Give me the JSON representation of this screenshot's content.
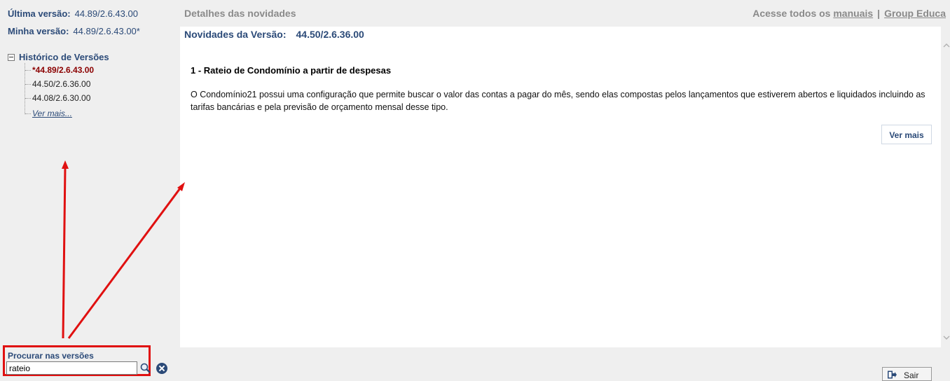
{
  "sidebar": {
    "ultima_label": "Última versão:",
    "ultima_value": "44.89/2.6.43.00",
    "minha_label": "Minha versão:",
    "minha_value": "44.89/2.6.43.00*",
    "history_title": "Histórico de Versões",
    "history_items": [
      {
        "label": "*44.89/2.6.43.00",
        "state": "current"
      },
      {
        "label": "44.50/2.6.36.00",
        "state": "normal"
      },
      {
        "label": "44.08/2.6.30.00",
        "state": "normal"
      }
    ],
    "ver_mais_link": "Ver mais..."
  },
  "search": {
    "label": "Procurar nas versões",
    "value": "rateio"
  },
  "header": {
    "title": "Detalhes das novidades",
    "links_prefix": "Acesse todos os",
    "manuais_link": "manuais",
    "separator": "|",
    "group_link": "Group Educa"
  },
  "content": {
    "novidades_label": "Novidades da Versão:",
    "novidades_version": "44.50/2.6.36.00",
    "item_title": "1 - Rateio de Condomínio a partir de despesas",
    "item_body": "O Condomínio21 possui uma configuração que permite buscar o valor das contas a pagar do mês, sendo elas compostas pelos lançamentos que estiverem abertos e liquidados incluindo as tarifas bancárias e pela previsão de orçamento mensal desse tipo.",
    "ver_mais_button": "Ver mais"
  },
  "footer": {
    "sair_button": "Sair"
  },
  "colors": {
    "accent": "#2b4a78",
    "current_version": "#8b0000",
    "annotation": "#e01010"
  }
}
